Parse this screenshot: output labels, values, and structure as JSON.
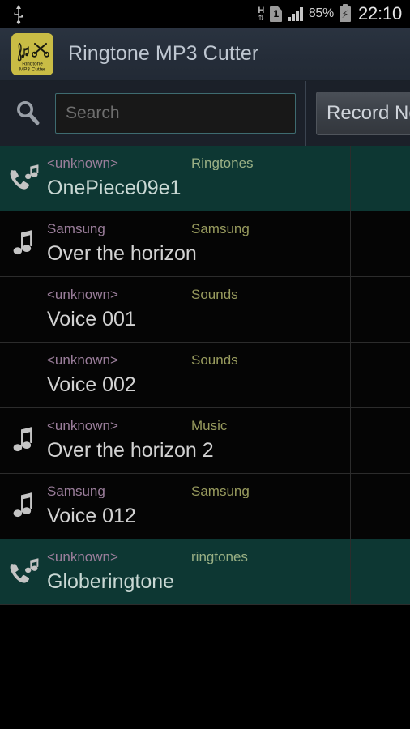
{
  "statusbar": {
    "usb_icon": "usb-icon",
    "network_label": "H",
    "network_arrows": "⇅",
    "sim_label": "1",
    "signal_icon": "signal-bars-icon",
    "battery_percent": "85%",
    "battery_icon": "battery-charging-icon",
    "clock": "22:10"
  },
  "actionbar": {
    "app_icon_name": "ringtone-mp3-cutter-app-icon",
    "app_icon_caption_line1": "Ringtone",
    "app_icon_caption_line2": "MP3 Cutter",
    "title": "Ringtone MP3 Cutter",
    "background_color": "#252d39"
  },
  "searchbar": {
    "search_icon": "search-icon",
    "input_value": "",
    "input_placeholder": "Search",
    "record_button_label": "Record New",
    "input_border_color": "#3e6b70"
  },
  "list": {
    "expand_icon": "chevron-down-triangle-icon",
    "accent_color": "#1fb5a0",
    "selected_row_color": "#0d3733",
    "artist_color": "#9b7e9b",
    "album_color": "#989b5e",
    "rows": [
      {
        "icon": "phone-ringtone-icon",
        "artist": "<unknown>",
        "album": "Ringtones",
        "title": "OnePiece09e1",
        "selected": true
      },
      {
        "icon": "music-note-icon",
        "artist": "Samsung",
        "album": "Samsung",
        "title": "Over the horizon",
        "selected": false
      },
      {
        "icon": "none",
        "artist": "<unknown>",
        "album": "Sounds",
        "title": "Voice 001",
        "selected": false
      },
      {
        "icon": "none",
        "artist": "<unknown>",
        "album": "Sounds",
        "title": "Voice 002",
        "selected": false
      },
      {
        "icon": "music-note-icon",
        "artist": "<unknown>",
        "album": "Music",
        "title": "Over the horizon 2",
        "selected": false
      },
      {
        "icon": "music-note-icon",
        "artist": "Samsung",
        "album": "Samsung",
        "title": "Voice 012",
        "selected": false
      },
      {
        "icon": "phone-ringtone-icon",
        "artist": "<unknown>",
        "album": "ringtones",
        "title": "Globeringtone",
        "selected": true
      }
    ]
  }
}
